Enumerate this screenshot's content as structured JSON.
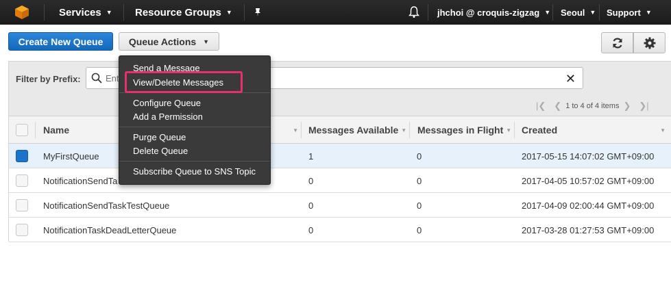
{
  "nav": {
    "services": "Services",
    "resource_groups": "Resource Groups",
    "user": "jhchoi @ croquis-zigzag",
    "region": "Seoul",
    "support": "Support"
  },
  "toolbar": {
    "create_label": "Create New Queue",
    "actions_label": "Queue Actions"
  },
  "filter": {
    "label": "Filter by Prefix:",
    "placeholder": "Enter Text"
  },
  "pager": {
    "text": "1 to 4 of 4 items"
  },
  "table": {
    "columns": [
      "Name",
      "Messages Available",
      "Messages in Flight",
      "Created"
    ],
    "rows": [
      {
        "name": "MyFirstQueue",
        "available": "1",
        "in_flight": "0",
        "created": "2017-05-15 14:07:02 GMT+09:00",
        "selected": true
      },
      {
        "name": "NotificationSendTa",
        "available": "0",
        "in_flight": "0",
        "created": "2017-04-05 10:57:02 GMT+09:00",
        "selected": false
      },
      {
        "name": "NotificationSendTaskTestQueue",
        "available": "0",
        "in_flight": "0",
        "created": "2017-04-09 02:00:44 GMT+09:00",
        "selected": false
      },
      {
        "name": "NotificationTaskDeadLetterQueue",
        "available": "0",
        "in_flight": "0",
        "created": "2017-03-28 01:27:53 GMT+09:00",
        "selected": false
      }
    ]
  },
  "menu": {
    "send": "Send a Message",
    "view_delete": "View/Delete Messages",
    "configure": "Configure Queue",
    "add_permission": "Add a Permission",
    "purge": "Purge Queue",
    "delete": "Delete Queue",
    "subscribe": "Subscribe Queue to SNS Topic"
  },
  "colors": {
    "primary": "#1a75c9",
    "highlight": "#e8306a",
    "nav_bg": "#1b1b1b"
  }
}
